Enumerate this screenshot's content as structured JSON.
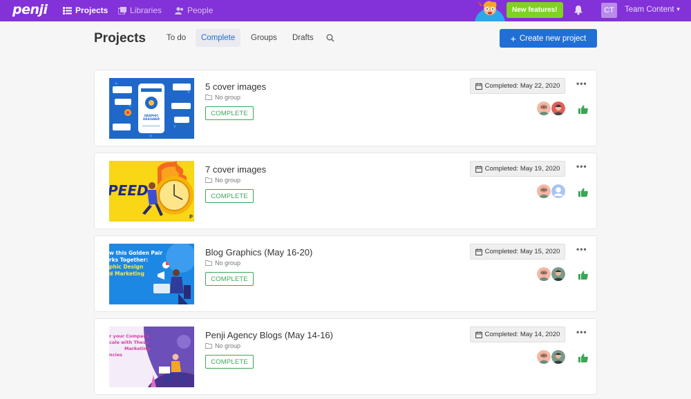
{
  "app": {
    "logo": "penji"
  },
  "nav": {
    "items": [
      {
        "label": "Projects",
        "icon": "list-icon",
        "active": true
      },
      {
        "label": "Libraries",
        "icon": "library-icon",
        "active": false
      },
      {
        "label": "People",
        "icon": "people-icon",
        "active": false
      }
    ],
    "new_features": "New features!",
    "user_initials": "CT",
    "user_team": "Team Content"
  },
  "header": {
    "title": "Projects",
    "tabs": [
      {
        "label": "To do",
        "active": false
      },
      {
        "label": "Complete",
        "active": true
      },
      {
        "label": "Groups",
        "active": false
      },
      {
        "label": "Drafts",
        "active": false
      }
    ],
    "create_button": "Create new project"
  },
  "projects": [
    {
      "title": "5 cover images",
      "group": "No group",
      "status": "COMPLETE",
      "completed": "Completed: May 22, 2020"
    },
    {
      "title": "7 cover images",
      "group": "No group",
      "status": "COMPLETE",
      "completed": "Completed: May 19, 2020"
    },
    {
      "title": "Blog Graphics (May 16-20)",
      "group": "No group",
      "status": "COMPLETE",
      "completed": "Completed: May 15, 2020"
    },
    {
      "title": "Penji Agency Blogs (May 14-16)",
      "group": "No group",
      "status": "COMPLETE",
      "completed": "Completed: May 14, 2020"
    }
  ],
  "thumbnails": {
    "t1": {
      "line1": "GRAPHIC",
      "line2": "DESIGNER"
    },
    "t2": {
      "text": "PEED"
    },
    "t3": {
      "line1": "w this Golden Pair",
      "line2": "rks Together:",
      "line3": "phic Design",
      "line4": "d Marketing"
    },
    "t4": {
      "line1": "r your Company",
      "line2": "cale with These",
      "line3": "Marketing",
      "line4": "ncies"
    }
  },
  "colors": {
    "nav_bg": "#8331d8",
    "primary": "#1f6fd6",
    "success": "#3aa655",
    "new_features": "#7ed321"
  }
}
